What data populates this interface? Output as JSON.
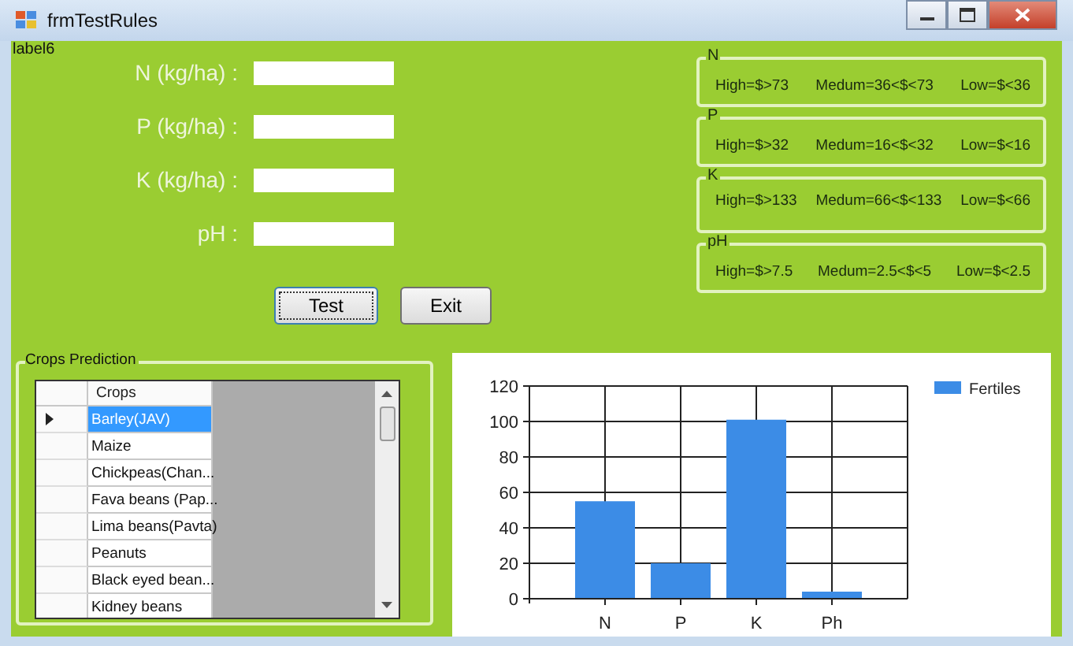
{
  "window": {
    "title": "frmTestRules"
  },
  "corner_label": "label6",
  "inputs": [
    {
      "label": "N (kg/ha) :"
    },
    {
      "label": "P (kg/ha) :"
    },
    {
      "label": "K (kg/ha) :"
    },
    {
      "label": "pH :"
    }
  ],
  "buttons": [
    {
      "label": "Test",
      "focused": true
    },
    {
      "label": "Exit",
      "focused": false
    }
  ],
  "rule_groups": [
    {
      "title": "N",
      "high": "High=$>73",
      "medium": "Medum=36<$<73",
      "low": "Low=$<36"
    },
    {
      "title": "P",
      "high": "High=$>32",
      "medium": "Medum=16<$<32",
      "low": "Low=$<16"
    },
    {
      "title": "K",
      "high": "High=$>133",
      "medium": "Medum=66<$<133",
      "low": "Low=$<66"
    },
    {
      "title": "pH",
      "high": "High=$>7.5",
      "medium": "Medum=2.5<$<5",
      "low": "Low=$<2.5"
    }
  ],
  "crops_group": {
    "title": "Crops Prediction",
    "column": "Crops",
    "rows": [
      {
        "crop": "Barley(JAV)",
        "selected": true
      },
      {
        "crop": "Maize",
        "selected": false
      },
      {
        "crop": "Chickpeas(Chan...",
        "selected": false
      },
      {
        "crop": "Fava beans (Pap...",
        "selected": false
      },
      {
        "crop": "Lima beans(Pavta)",
        "selected": false
      },
      {
        "crop": "Peanuts",
        "selected": false
      },
      {
        "crop": "Black eyed bean...",
        "selected": false
      },
      {
        "crop": "Kidney beans",
        "selected": false
      }
    ]
  },
  "chart_data": {
    "type": "bar",
    "categories": [
      "N",
      "P",
      "K",
      "Ph"
    ],
    "series": [
      {
        "name": "Fertiles",
        "color": "#3c8ce6",
        "values": [
          55,
          20,
          101,
          4
        ]
      }
    ],
    "grid": true,
    "ylim": [
      0,
      120
    ],
    "yticks": [
      0,
      20,
      40,
      60,
      80,
      100,
      120
    ]
  }
}
